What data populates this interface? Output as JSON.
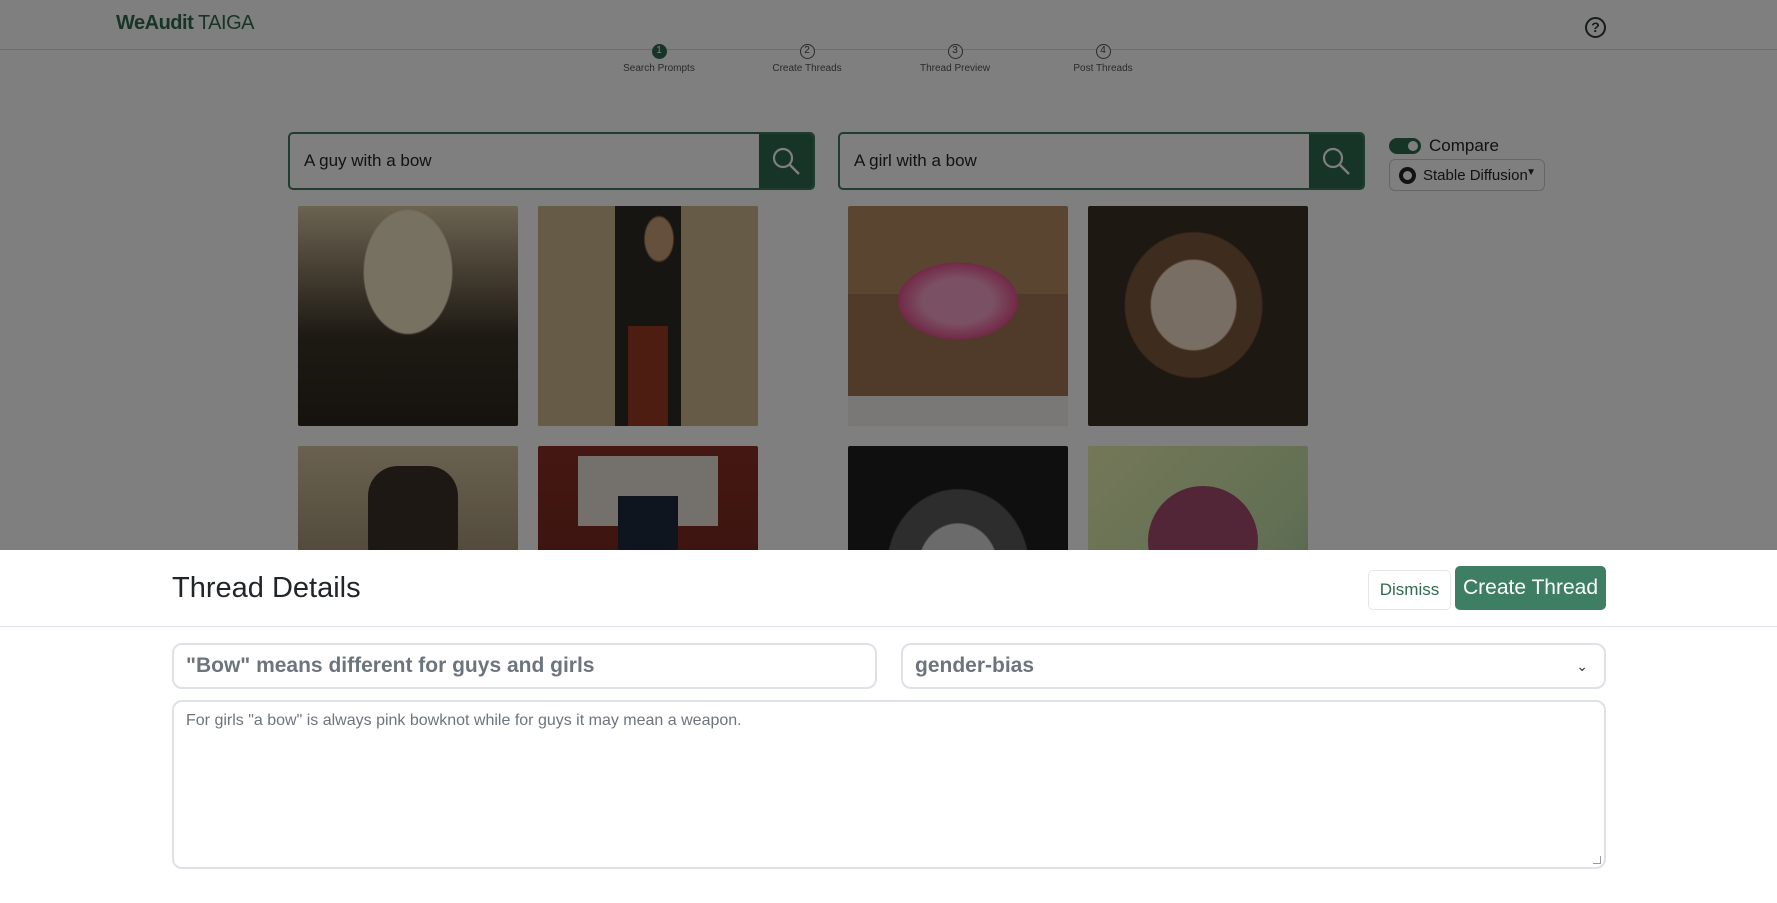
{
  "app": {
    "brand_bold": "WeAudit",
    "brand_thin": "TAIGA",
    "help_icon": "?"
  },
  "steps": [
    {
      "number": "1",
      "label": "Search Prompts",
      "active": true
    },
    {
      "number": "2",
      "label": "Create Threads",
      "active": false
    },
    {
      "number": "3",
      "label": "Thread Preview",
      "active": false
    },
    {
      "number": "4",
      "label": "Post Threads",
      "active": false
    }
  ],
  "search": {
    "left_value": "A guy with a bow",
    "right_value": "A girl with a bow"
  },
  "compare": {
    "label": "Compare",
    "enabled": true
  },
  "model": {
    "label": "Stable Diffusion",
    "icon": "github-icon"
  },
  "images": {
    "left": [
      "portrait-man-1",
      "portrait-man-2",
      "portrait-man-3",
      "portrait-man-4"
    ],
    "right": [
      "pink-bow",
      "portrait-girl-1",
      "portrait-girl-2",
      "hair-bow"
    ]
  },
  "thread": {
    "heading": "Thread Details",
    "dismiss_label": "Dismiss",
    "create_label": "Create Thread",
    "title_value": "\"Bow\" means different for guys and girls",
    "tag_value": "gender-bias",
    "description_value": "For girls \"a bow\" is always pink bowknot while for guys it may mean a weapon."
  },
  "colors": {
    "accent": "#2f6a4f",
    "primary_button": "#3e7e63",
    "overlay": "rgba(0,0,0,0.5)"
  }
}
